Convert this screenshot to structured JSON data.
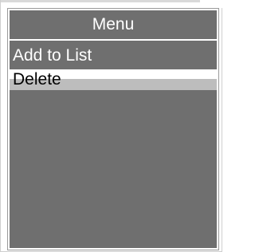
{
  "menu": {
    "title": "Menu",
    "items": [
      {
        "label": "Add to List",
        "selected": false
      },
      {
        "label": "Delete",
        "selected": true
      }
    ]
  }
}
